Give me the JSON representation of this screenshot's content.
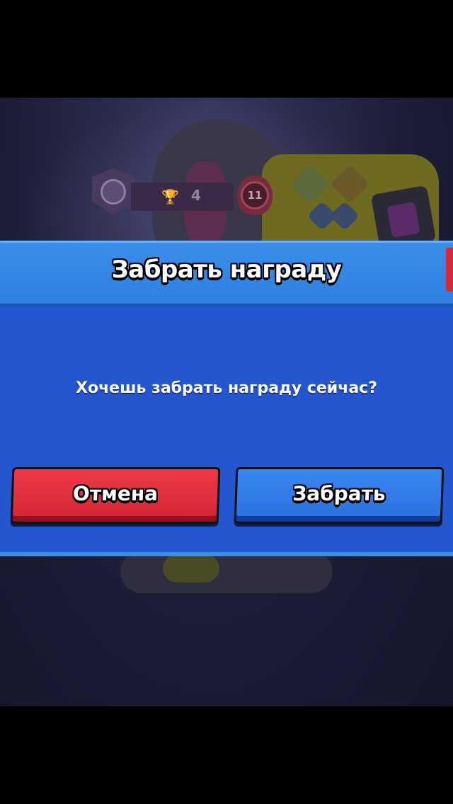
{
  "hud": {
    "trophy_count": "4",
    "level": "11"
  },
  "dialog": {
    "title": "Забрать награду",
    "question": "Хочешь забрать награду сейчас?",
    "cancel_label": "Отмена",
    "confirm_label": "Забрать"
  },
  "colors": {
    "header": "#3a8ee8",
    "body": "#2456cf",
    "cancel_button": "#e0303e",
    "confirm_button": "#2f7ae8"
  },
  "icons": [
    "rank-skull-icon",
    "trophy-icon",
    "level-flame-icon",
    "gadget-icon",
    "star-power-icon",
    "close-icon"
  ]
}
